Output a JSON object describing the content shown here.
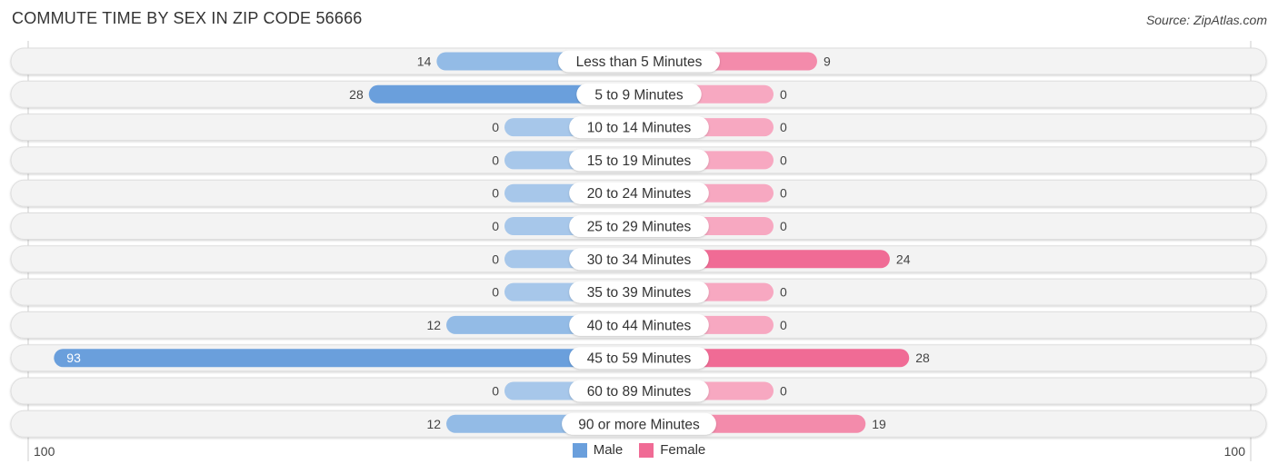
{
  "chart_data": {
    "type": "bar",
    "orientation": "horizontal-diverging",
    "title": "COMMUTE TIME BY SEX IN ZIP CODE 56666",
    "source": "Source: ZipAtlas.com",
    "categories": [
      "Less than 5 Minutes",
      "5 to 9 Minutes",
      "10 to 14 Minutes",
      "15 to 19 Minutes",
      "20 to 24 Minutes",
      "25 to 29 Minutes",
      "30 to 34 Minutes",
      "35 to 39 Minutes",
      "40 to 44 Minutes",
      "45 to 59 Minutes",
      "60 to 89 Minutes",
      "90 or more Minutes"
    ],
    "series": [
      {
        "name": "Male",
        "color": "#6a9fdc",
        "color_light": "#a7c7ea",
        "values": [
          14,
          28,
          0,
          0,
          0,
          0,
          0,
          0,
          12,
          93,
          0,
          12
        ]
      },
      {
        "name": "Female",
        "color": "#f06b95",
        "color_light": "#f7a8c1",
        "values": [
          9,
          0,
          0,
          0,
          0,
          0,
          24,
          0,
          0,
          28,
          0,
          19
        ]
      }
    ],
    "axis": {
      "left_label": "100",
      "right_label": "100",
      "max": 100
    },
    "legend": {
      "position": "bottom-center",
      "items": [
        "Male",
        "Female"
      ]
    }
  }
}
